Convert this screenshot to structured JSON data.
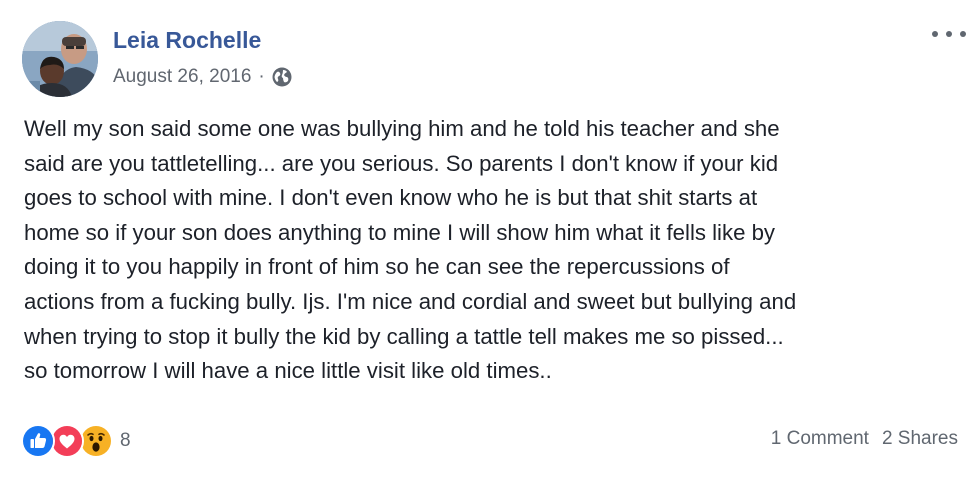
{
  "post": {
    "author": "Leia Rochelle",
    "date": "August 26, 2016",
    "separator": "·",
    "privacy_icon": "globe-icon",
    "more_icon": "more-options-icon",
    "body_lines": [
      "Well my son said some one was bullying him and he told his teacher and she",
      "said are you tattletelling... are you serious. So parents I don't know if your kid",
      "goes to school with mine. I don't even know who he is but that shit starts at",
      "home so if your son does anything to mine I will show him what it fells like by",
      "doing it to you happily in front of him so he can see the repercussions of",
      "actions from a fucking bully. Ijs. I'm nice and cordial and sweet but bullying and",
      "when trying to stop it bully the kid by calling a tattle tell makes me so pissed...",
      "so tomorrow I will have a nice little visit like old times.."
    ]
  },
  "reactions": {
    "icons": [
      "like-reaction-icon",
      "love-reaction-icon",
      "wow-reaction-icon"
    ],
    "count": "8"
  },
  "stats": {
    "comments": "1 Comment",
    "shares": "2 Shares"
  },
  "colors": {
    "author": "#385898",
    "meta": "#616770",
    "body": "#1d2129",
    "like": "#1877f2",
    "love": "#f33e58",
    "wow": "#f7b125"
  }
}
